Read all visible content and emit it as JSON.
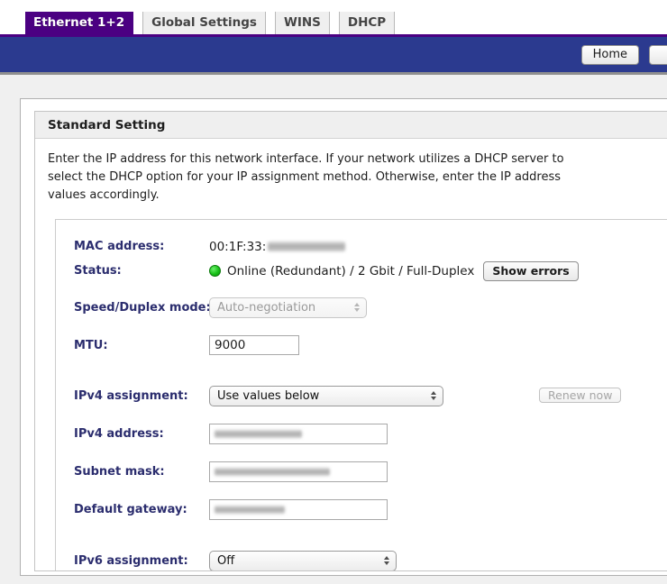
{
  "tabs": [
    {
      "label": "Ethernet 1+2",
      "active": true
    },
    {
      "label": "Global Settings",
      "active": false
    },
    {
      "label": "WINS",
      "active": false
    },
    {
      "label": "DHCP",
      "active": false
    }
  ],
  "header": {
    "home_label": "Home",
    "secondary_label": "",
    "bar_color": "#2b3a8f",
    "accent_color": "#4b0082"
  },
  "panel": {
    "title": "Standard Setting",
    "description": "Enter the IP address for this network interface. If your network utilizes a DHCP server to\nselect the DHCP option for your IP assignment method. Otherwise, enter the IP address\nvalues accordingly."
  },
  "form": {
    "mac": {
      "label": "MAC address:",
      "value": "00:1F:33:",
      "redacted": true
    },
    "status": {
      "label": "Status:",
      "value": "Online (Redundant) / 2 Gbit / Full-Duplex",
      "dot_color": "#18c018",
      "button_label": "Show errors"
    },
    "speed_duplex": {
      "label": "Speed/Duplex mode:",
      "value": "Auto-negotiation",
      "disabled": true
    },
    "mtu": {
      "label": "MTU:",
      "value": "9000"
    },
    "ipv4_assignment": {
      "label": "IPv4 assignment:",
      "value": "Use values below",
      "button_label": "Renew now",
      "button_disabled": true
    },
    "ipv4_address": {
      "label": "IPv4 address:",
      "value": "",
      "redacted": true
    },
    "subnet_mask": {
      "label": "Subnet mask:",
      "value": "",
      "redacted": true
    },
    "default_gateway": {
      "label": "Default gateway:",
      "value": "",
      "redacted": true
    },
    "ipv6_assignment": {
      "label": "IPv6 assignment:",
      "value": "Off"
    }
  }
}
